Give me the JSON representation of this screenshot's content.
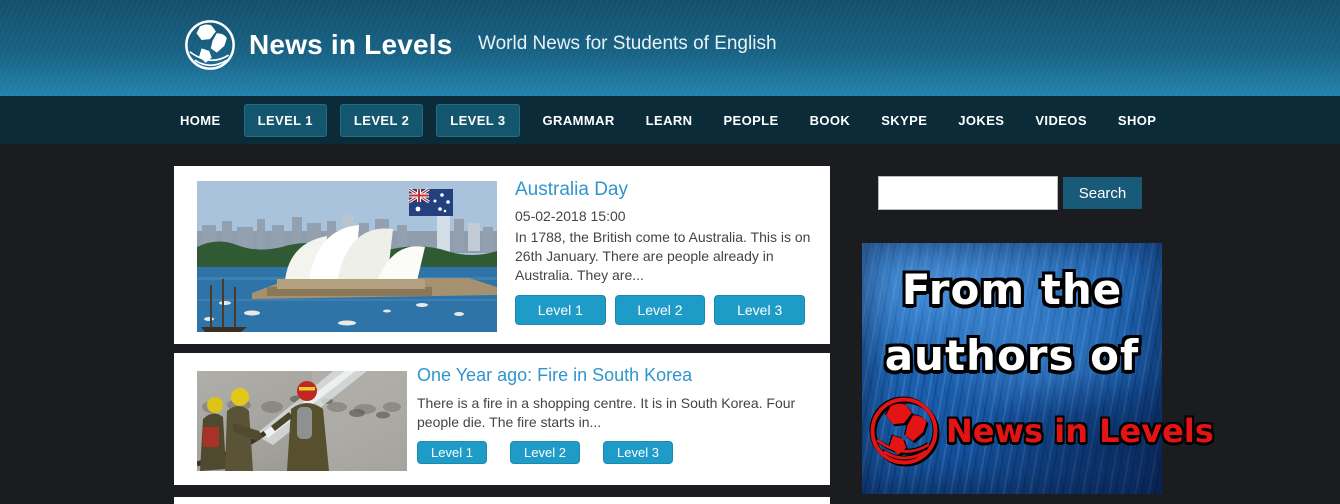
{
  "header": {
    "logo_text": "News in Levels",
    "tagline": "World News for Students of English"
  },
  "nav": {
    "items": [
      {
        "label": "HOME",
        "highlighted": false
      },
      {
        "label": "LEVEL 1",
        "highlighted": true
      },
      {
        "label": "LEVEL 2",
        "highlighted": true
      },
      {
        "label": "LEVEL 3",
        "highlighted": true
      },
      {
        "label": "GRAMMAR",
        "highlighted": false
      },
      {
        "label": "LEARN",
        "highlighted": false
      },
      {
        "label": "PEOPLE",
        "highlighted": false
      },
      {
        "label": "BOOK",
        "highlighted": false
      },
      {
        "label": "SKYPE",
        "highlighted": false
      },
      {
        "label": "JOKES",
        "highlighted": false
      },
      {
        "label": "VIDEOS",
        "highlighted": false
      },
      {
        "label": "SHOP",
        "highlighted": false
      }
    ]
  },
  "search": {
    "value": "",
    "placeholder": "",
    "button_label": "Search"
  },
  "articles": [
    {
      "title": "Australia Day",
      "date": "05-02-2018 15:00",
      "excerpt": "In 1788, the British come to Australia. This is on 26th January. There are people already in Australia. They are...",
      "levels": [
        "Level 1",
        "Level 2",
        "Level 3"
      ],
      "image": "sydney-opera-house-with-australian-flag"
    },
    {
      "title": "One Year ago: Fire in South Korea",
      "excerpt": "There is a fire in a shopping centre. It is in South Korea. Four people die. The fire starts in...",
      "levels": [
        "Level 1",
        "Level 2",
        "Level 3"
      ],
      "image": "firefighters-spraying-water-in-smoke"
    }
  ],
  "sidebar_banner": {
    "line1": "From the",
    "line2": "authors of",
    "brand": "News in Levels"
  },
  "colors": {
    "header_gradient_top": "#134f6b",
    "header_gradient_bottom": "#2383ae",
    "nav_bg": "#0c2b38",
    "nav_level_button_bg": "#14566e",
    "page_bg": "#1b1c1f",
    "card_bg": "#ffffff",
    "article_link": "#3095cf",
    "level_button": "#1e9cc7",
    "search_button_bg": "#195a78",
    "banner_red": "#e41414",
    "banner_blue": "#1d64b4"
  }
}
